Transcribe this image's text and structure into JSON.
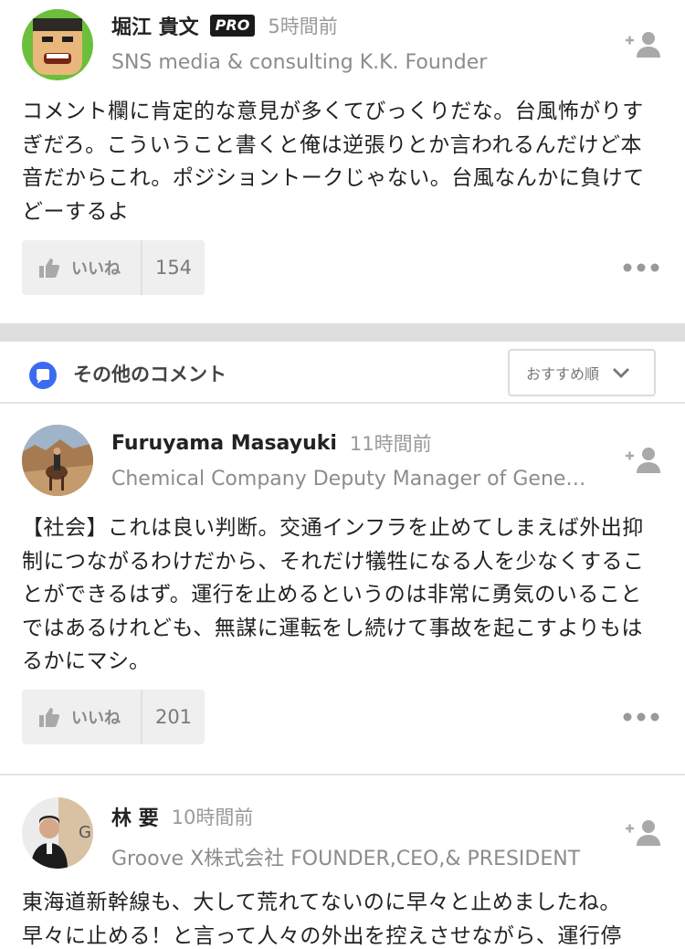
{
  "comments": [
    {
      "name": "堀江 貴文",
      "badge": "PRO",
      "time": "5時間前",
      "org": "SNS media & consulting K.K. Founder",
      "body": "コメント欄に肯定的な意見が多くてびっくりだな。台風怖がりすぎだろ。こういうこと書くと俺は逆張りとか言われるんだけど本音だからこれ。ポジショントークじゃない。台風なんかに負けてどーするよ",
      "like_label": "いいね",
      "like_count": "154"
    },
    {
      "name": "Furuyama Masayuki",
      "time": "11時間前",
      "org": "Chemical Company Deputy Manager of Gene…",
      "body": "【社会】これは良い判断。交通インフラを止めてしまえば外出抑制につながるわけだから、それだけ犠牲になる人を少なくすることができるはず。運行を止めるというのは非常に勇気のいることではあるけれども、無謀に運転をし続けて事故を起こすよりもはるかにマシ。",
      "like_label": "いいね",
      "like_count": "201"
    },
    {
      "name": "林 要",
      "time": "10時間前",
      "org": "Groove X株式会社 FOUNDER,CEO,& PRESIDENT",
      "body": "東海道新幹線も、大して荒れてないのに早々と止めましたね。早々に止める！と言って人々の外出を控えさせながら、運行停"
    }
  ],
  "section": {
    "title": "その他のコメント",
    "sort_label": "おすすめ順"
  },
  "icons": {
    "follow": "add-user-icon",
    "like": "thumbs-up-icon",
    "more": "more-dots-icon",
    "section": "comment-bubble-icon",
    "sort": "chevron-down-icon"
  },
  "colors": {
    "icon_gray": "#a9a9a9",
    "section_icon": "#3b6cf0",
    "divider": "#dedede"
  }
}
